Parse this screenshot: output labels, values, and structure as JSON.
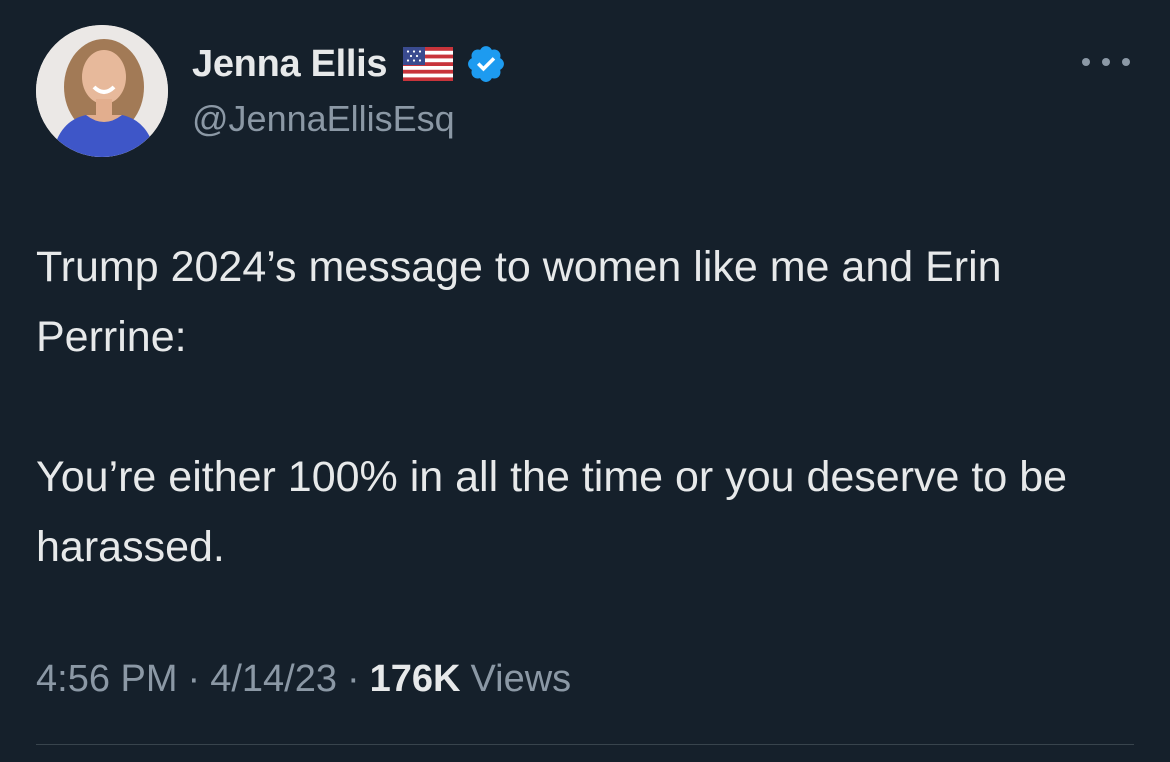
{
  "author": {
    "name": "Jenna Ellis",
    "flag_icon": "us-flag-icon",
    "verified_icon": "verified-badge-icon",
    "handle": "@JennaEllisEsq"
  },
  "tweet": {
    "paragraphs": [
      "Trump 2024’s message to women like me and Erin Perrine:",
      "You’re either 100% in all the time or you deserve to be harassed."
    ]
  },
  "meta": {
    "time": "4:56 PM",
    "separator": "·",
    "date": "4/14/23",
    "views_count": "176K",
    "views_label": "Views"
  },
  "colors": {
    "background": "#15202b",
    "primary_text": "#e7e9ea",
    "secondary_text": "#8b98a5",
    "verified_blue": "#1d9bf0",
    "divider": "#38444d"
  },
  "icons": {
    "more": "more-options-icon"
  }
}
